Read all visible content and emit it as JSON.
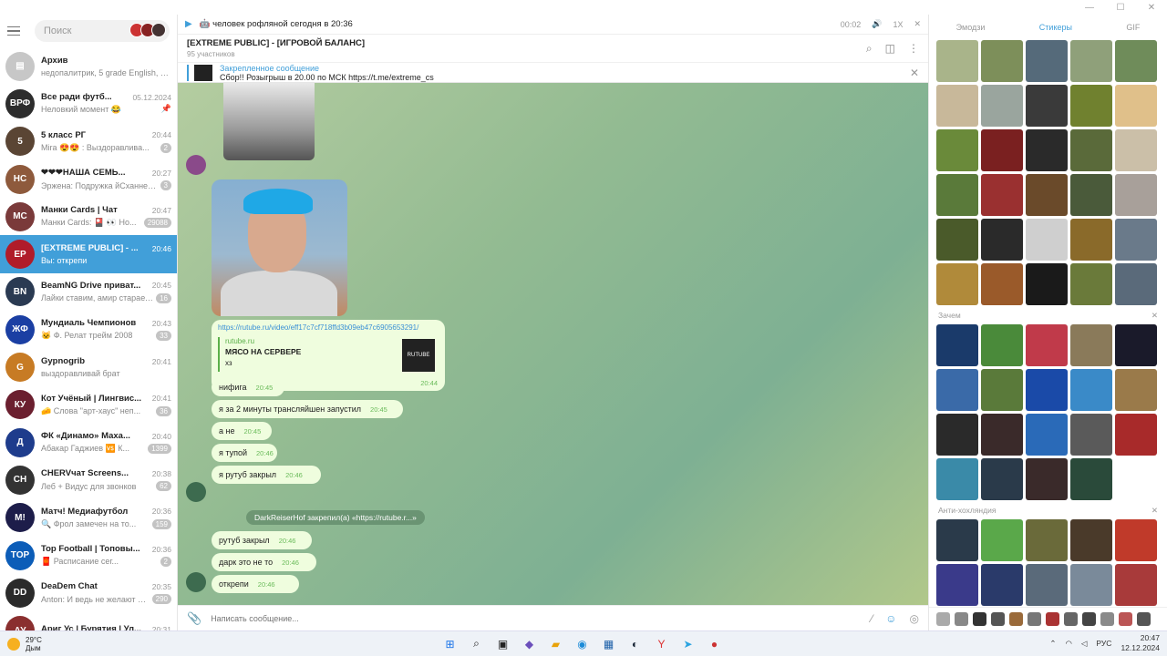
{
  "sidebar": {
    "search_placeholder": "Поиск",
    "chats": [
      {
        "name": "Архив",
        "preview": "недопалитрик, 5 grade English, X...",
        "time": "",
        "badge": "",
        "color": "#c7c7c7",
        "initials": "▤"
      },
      {
        "name": "Все ради футб...",
        "preview": "Неловкий момент 😂",
        "time": "05.12.2024",
        "badge": "",
        "color": "#2d2d2d",
        "initials": "ВРФ",
        "pinned": true
      },
      {
        "name": "5 класс РГ",
        "preview": "Mira 😍😍 : Выздоравлива...",
        "time": "20:44",
        "badge": "2",
        "color": "#5a4534",
        "initials": "5"
      },
      {
        "name": "❤❤❤НАША СЕМЬ...",
        "preview": "Эржена: Подружка йСханнес...",
        "time": "20:27",
        "badge": "3",
        "color": "#8e5a3c",
        "initials": "НС"
      },
      {
        "name": "Манки Cards | Чат",
        "preview": "Манки Cards: 🎴 👀 Но...",
        "time": "20:47",
        "badge": "29088",
        "color": "#7a3a3a",
        "initials": "MC"
      },
      {
        "name": "[EXTREME PUBLIC] - ...",
        "preview": "Вы: открепи",
        "time": "20:46",
        "badge": "",
        "color": "#b01c2a",
        "initials": "EP",
        "active": true
      },
      {
        "name": "BeamNG Drive приват...",
        "preview": "Лайки ставим, амир старает...",
        "time": "20:45",
        "badge": "16",
        "color": "#2a3a52",
        "initials": "BN"
      },
      {
        "name": "Мундиаль Чемпионов",
        "preview": "🐱 Ф. Релат трейм 2008",
        "time": "20:43",
        "badge": "33",
        "color": "#1b3fa3",
        "initials": "ЖФ"
      },
      {
        "name": "Gypnogrib",
        "preview": "выздоравливай брат",
        "time": "20:41",
        "badge": "",
        "color": "#c77b24",
        "initials": "G"
      },
      {
        "name": "Кот Учёный | Лингвис...",
        "preview": "🧀 Слова \"арт-хаус\" неп...",
        "time": "20:41",
        "badge": "36",
        "color": "#6b1f2f",
        "initials": "КУ"
      },
      {
        "name": "ФК «Динамо» Маха...",
        "preview": "Абакар Гаджиев 🆚 К...",
        "time": "20:40",
        "badge": "1399",
        "color": "#1e3c8c",
        "initials": "Д"
      },
      {
        "name": "CHERVчат Screens...",
        "preview": "Леб + Видус для звонков",
        "time": "20:38",
        "badge": "62",
        "color": "#333",
        "initials": "CH"
      },
      {
        "name": "Матч! Медиафутбол",
        "preview": "🔍 Фрол замечен на то...",
        "time": "20:36",
        "badge": "159",
        "color": "#1d1d4a",
        "initials": "M!"
      },
      {
        "name": "Top Football | Топовы...",
        "preview": "🧧 Расписание сег...",
        "time": "20:36",
        "badge": "2",
        "color": "#0c5db8",
        "initials": "TOP"
      },
      {
        "name": "DeaDem Chat",
        "preview": "Anton: И ведь не желают д...",
        "time": "20:35",
        "badge": "290",
        "color": "#2b2b2b",
        "initials": "DD"
      },
      {
        "name": "Ариг Ус | Бурятия | Ул...",
        "preview": "",
        "time": "20:31",
        "badge": "",
        "color": "#8a2f2f",
        "initials": "АУ"
      }
    ]
  },
  "player": {
    "title": "🤖 человек рофляной сегодня в 20:36",
    "time": "00:02",
    "speed": "1X"
  },
  "header": {
    "title": "[EXTREME PUBLIC] - [ИГРОВОЙ БАЛАНС]",
    "subtitle": "95 участников"
  },
  "pinned": {
    "label": "Закрепленное сообщение",
    "text": "Сбор!! Розыгрыш в 20.00 по МСК https://t.me/extreme_cs"
  },
  "messages": {
    "link": {
      "url": "https://rutube.ru/video/eff17c7cf718ffd3b09eb47c6905653291/",
      "site": "rutube.ru",
      "title": "МЯСО НА СЕРВЕРЕ",
      "desc": "хз",
      "thumb": "RUTUBE",
      "time": "20:44"
    },
    "bubbles": [
      {
        "text": "нифига",
        "time": "20:45"
      },
      {
        "text": "я за 2 минуты трансляйшен запустил",
        "time": "20:45"
      },
      {
        "text": "а не",
        "time": "20:45"
      },
      {
        "text": "я тупой",
        "time": "20:46"
      },
      {
        "text": "я рутуб закрыл",
        "time": "20:46"
      },
      {
        "text": "рутуб закрыл",
        "time": "20:46"
      },
      {
        "text": "дарк это не то",
        "time": "20:46"
      },
      {
        "text": "открепи",
        "time": "20:46"
      }
    ],
    "service": "DarkReiserHof закрепил(а) «https://rutube.r...»"
  },
  "composer": {
    "placeholder": "Написать сообщение..."
  },
  "panel": {
    "tabs": [
      "Эмодзи",
      "Стикеры",
      "GIF"
    ],
    "sections": [
      "Зачем",
      "Анти-хохляндия"
    ]
  },
  "taskbar": {
    "temp": "29°C",
    "weather": "Дым",
    "lang": "РУС",
    "time": "20:47",
    "date": "12.12.2024"
  }
}
